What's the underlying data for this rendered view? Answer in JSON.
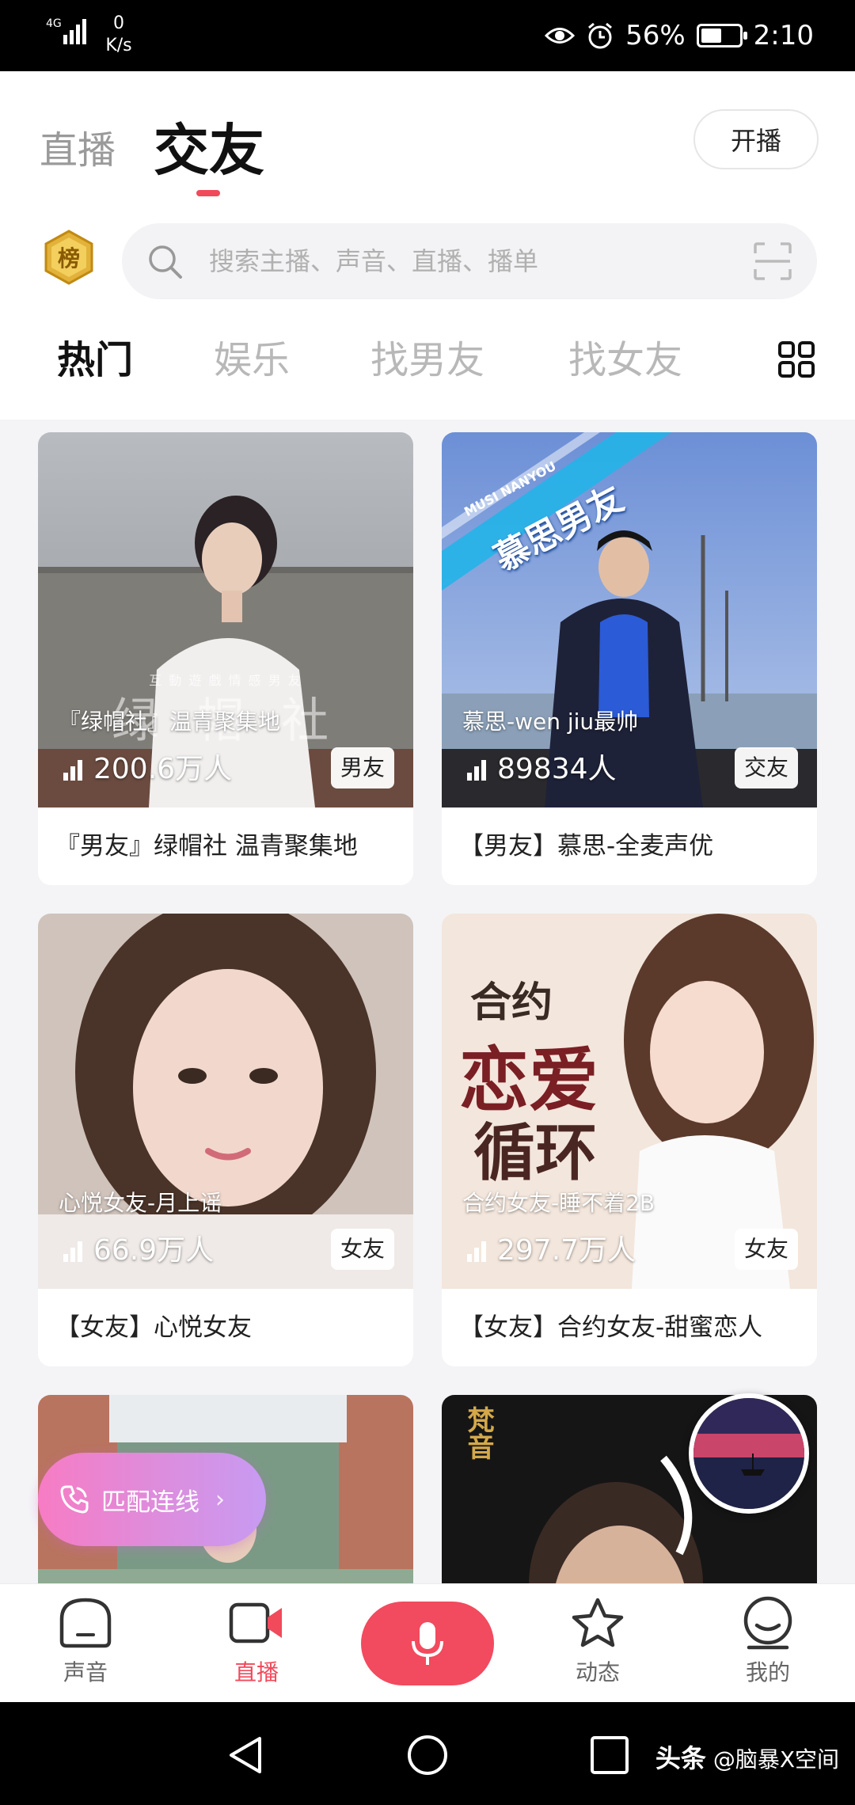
{
  "status_bar": {
    "network_type": "4G",
    "speed_value": "0",
    "speed_unit": "K/s",
    "battery": "56%",
    "battery_level": 0.56,
    "time": "2:10"
  },
  "header": {
    "tab_live": "直播",
    "tab_friends": "交友",
    "start_broadcast": "开播",
    "rank_badge": "榜"
  },
  "search": {
    "placeholder": "搜索主播、声音、直播、播单"
  },
  "categories": [
    "热门",
    "娱乐",
    "找男友",
    "找女友"
  ],
  "cards": [
    {
      "host": "『绿帽社』温青聚集地",
      "count": "200.6万人",
      "tag": "男友",
      "title": "『男友』绿帽社 温青聚集地",
      "overlay": "绿 帽 社",
      "overlay_small": "互 動 遊 戲   情 感 男 友"
    },
    {
      "host": "慕思-wen jiu最帅",
      "count": "89834人",
      "tag": "交友",
      "title": "【男友】慕思-全麦声优",
      "banner": "慕思男友",
      "banner_small": "MUSI NANYOU"
    },
    {
      "host": "心悦女友-月上谣",
      "count": "66.9万人",
      "tag": "女友",
      "title": "【女友】心悦女友"
    },
    {
      "host": "合约女友-睡不着2B",
      "count": "297.7万人",
      "tag": "女友",
      "title": "【女友】合约女友-甜蜜恋人",
      "poster_text_1": "合约",
      "poster_text_2": "恋爱",
      "poster_text_3": "循环"
    },
    {
      "host": "",
      "count": "",
      "tag": "",
      "title": ""
    },
    {
      "host": "",
      "count": "",
      "tag": "",
      "title": "",
      "logo_text": "梵音"
    }
  ],
  "match_button": {
    "label": "匹配连线",
    "chevron": "›"
  },
  "bottom_nav": {
    "items": [
      {
        "label": "声音",
        "icon": "home-icon"
      },
      {
        "label": "直播",
        "icon": "video-camera-icon",
        "active": true
      },
      {
        "label": "",
        "icon": "microphone-icon"
      },
      {
        "label": "动态",
        "icon": "star-icon"
      },
      {
        "label": "我的",
        "icon": "profile-icon"
      }
    ]
  },
  "watermark": {
    "brand": "头条",
    "account": "@脑暴X空间"
  },
  "colors": {
    "accent": "#f04a5b",
    "match_gradient_start": "#f77cc4",
    "match_gradient_end": "#c79bf2"
  }
}
